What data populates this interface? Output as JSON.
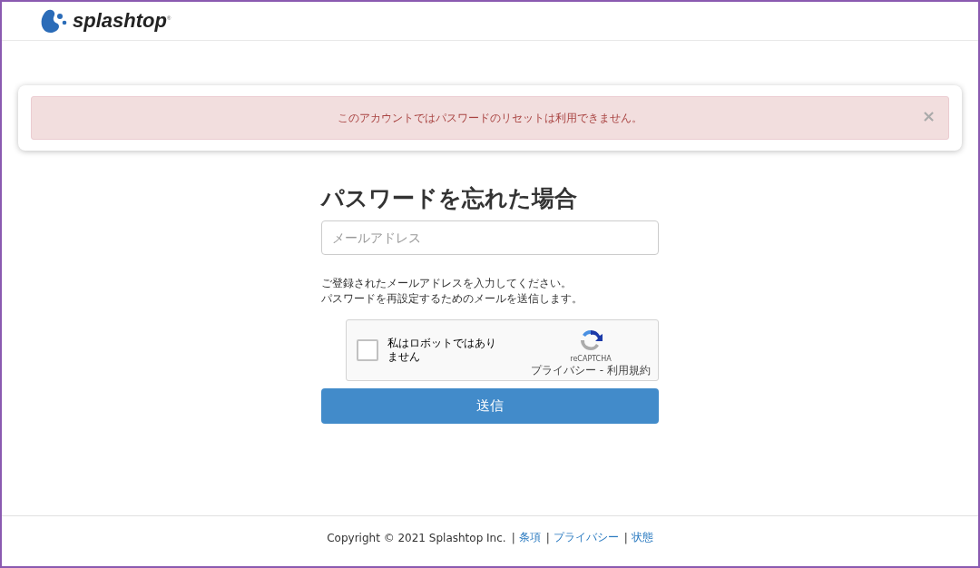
{
  "header": {
    "logo_text": "splashtop",
    "logo_mark": "®"
  },
  "alert": {
    "message": "このアカウントではパスワードのリセットは利用できません。",
    "close": "×"
  },
  "form": {
    "title": "パスワードを忘れた場合",
    "email": {
      "placeholder": "メールアドレス"
    },
    "instructions": [
      "ご登録されたメールアドレスを入力してください。",
      "パスワードを再設定するためのメールを送信します。"
    ],
    "captcha": {
      "label": "私はロボットではありません",
      "checked": false,
      "brand": "reCAPTCHA",
      "privacy": "プライバシー",
      "separator": "-",
      "terms": "利用規約"
    },
    "submit": "送信"
  },
  "footer": {
    "copyright": "Copyright © 2021 Splashtop Inc.",
    "links": [
      "条項",
      "プライバシー",
      "状態"
    ],
    "separator": "|"
  }
}
